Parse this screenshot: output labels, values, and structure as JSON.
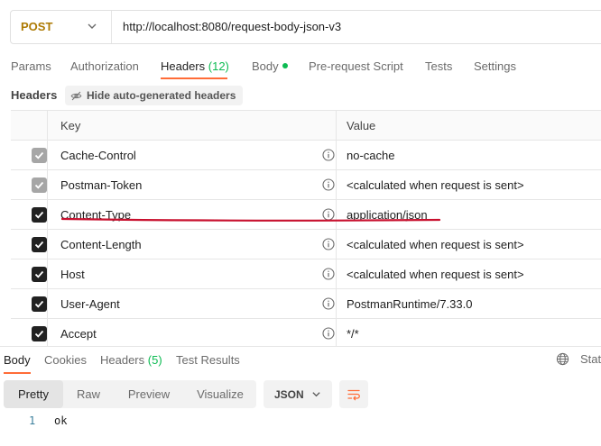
{
  "request": {
    "method": "POST",
    "url": "http://localhost:8080/request-body-json-v3"
  },
  "request_tabs": [
    {
      "label": "Params"
    },
    {
      "label": "Authorization"
    },
    {
      "label": "Headers",
      "count": "(12)"
    },
    {
      "label": "Body"
    },
    {
      "label": "Pre-request Script"
    },
    {
      "label": "Tests"
    },
    {
      "label": "Settings"
    }
  ],
  "headers_section": {
    "label": "Headers",
    "hide_button": "Hide auto-generated headers"
  },
  "table": {
    "col_key": "Key",
    "col_value": "Value",
    "rows": [
      {
        "key": "Cache-Control",
        "value": "no-cache"
      },
      {
        "key": "Postman-Token",
        "value": "<calculated when request is sent>"
      },
      {
        "key": "Content-Type",
        "value": "application/json"
      },
      {
        "key": "Content-Length",
        "value": "<calculated when request is sent>"
      },
      {
        "key": "Host",
        "value": "<calculated when request is sent>"
      },
      {
        "key": "User-Agent",
        "value": "PostmanRuntime/7.33.0"
      },
      {
        "key": "Accept",
        "value": "*/*"
      }
    ]
  },
  "response_tabs": [
    {
      "label": "Body"
    },
    {
      "label": "Cookies"
    },
    {
      "label": "Headers",
      "count": "(5)"
    },
    {
      "label": "Test Results"
    }
  ],
  "response_status_label": "Stat",
  "view_modes": [
    "Pretty",
    "Raw",
    "Preview",
    "Visualize"
  ],
  "format": "JSON",
  "body_lines": [
    {
      "no": "1",
      "text": "ok"
    }
  ],
  "colors": {
    "accent": "#ff6c37",
    "method_post": "#ad7a03",
    "count_green": "#0cbb52",
    "annotation_red": "#c8102e"
  }
}
